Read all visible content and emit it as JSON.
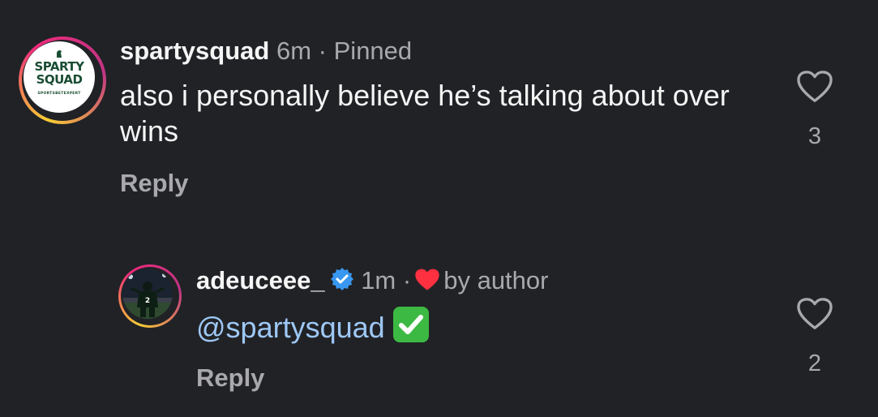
{
  "comments": [
    {
      "username": "spartysquad",
      "time": "6m",
      "separator": "·",
      "badge": "Pinned",
      "avatar": {
        "line1": "SPARTY",
        "line2": "SQUAD",
        "tagline": "SPORTSBETEXPERT"
      },
      "text": "also i personally believe he’s talking about over wins",
      "reply_label": "Reply",
      "like_count": "3"
    },
    {
      "username": "adeuceee_",
      "verified": true,
      "time": "1m",
      "separator": "·",
      "liked_by": "by author",
      "mention": "@spartysquad",
      "emoji": "white-check-mark",
      "reply_label": "Reply",
      "like_count": "2",
      "avatar": {
        "jersey": "2"
      }
    }
  ],
  "colors": {
    "background": "#212226",
    "text_primary": "#f5f5f5",
    "text_secondary": "#a8a8ad",
    "mention": "#9ec8f5",
    "verified": "#3897f0",
    "heart_red": "#ff3040",
    "check_green": "#3cb943"
  }
}
